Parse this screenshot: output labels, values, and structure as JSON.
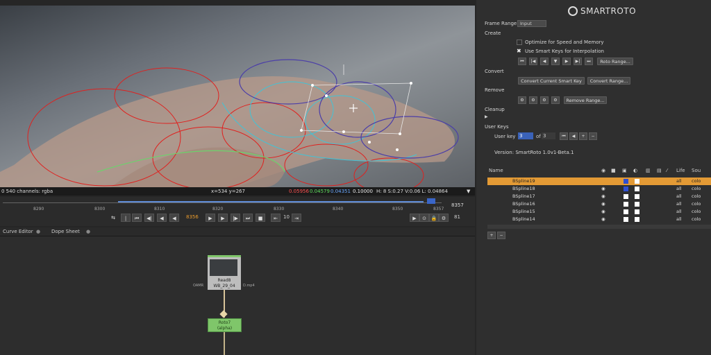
{
  "viewer": {
    "status_left": "0 540 channels: rgba",
    "coords": "x=534 y=267",
    "r": "0.05956",
    "g": "0.04579",
    "b": "0.04351",
    "a": "0.10000",
    "hsvl": "H: 8 S:0.27 V:0.06  L: 0.04864"
  },
  "timeline": {
    "ticks": [
      "8290",
      "8300",
      "8310",
      "8320",
      "8330",
      "8340",
      "8350",
      "8357"
    ],
    "end_frame": "8357",
    "current_frame": "8356",
    "step": "10",
    "fps": "81"
  },
  "tabs": [
    "Curve Editor",
    "Dope Sheet"
  ],
  "nodes": {
    "read": {
      "title": "Read8",
      "subtitle": "WB_29_04",
      "left_label": "OAMR",
      "right_label": "D.mp4"
    },
    "roto": {
      "title": "Roto7",
      "subtitle": "(alpha)"
    }
  },
  "panel": {
    "logo": "SMARTROTO",
    "frame_range_label": "Frame Range",
    "frame_range_value": "Input",
    "create_label": "Create",
    "optimize_label": "Optimize for Speed and Memory",
    "smart_keys_label": "Use Smart Keys for Interpolation",
    "roto_range_btn": "Roto Range...",
    "convert_label": "Convert",
    "convert_current_btn": "Convert Current Smart Key",
    "convert_range_btn": "Convert Range...",
    "remove_label": "Remove",
    "remove_range_btn": "Remove Range...",
    "cleanup_label": "Cleanup",
    "user_keys_label": "User Keys",
    "user_key_label": "User key",
    "user_key_value": "3",
    "of_label": "of",
    "of_value": "3",
    "version": "Version:  SmartRoto 1.0v1-Beta.1"
  },
  "table": {
    "headers": {
      "name": "Name",
      "life": "Life",
      "source": "Sou"
    },
    "rows": [
      {
        "name": "BSpline19",
        "life": "all",
        "src": "colo"
      },
      {
        "name": "BSpline18",
        "life": "all",
        "src": "colo"
      },
      {
        "name": "BSpline17",
        "life": "all",
        "src": "colo"
      },
      {
        "name": "BSpline16",
        "life": "all",
        "src": "colo"
      },
      {
        "name": "BSpline15",
        "life": "all",
        "src": "colo"
      },
      {
        "name": "BSpline14",
        "life": "all",
        "src": "colo"
      }
    ]
  },
  "colors": {
    "accent": "#e89a2c",
    "selected_row": "#e39a35",
    "node_green": "#7fc66a"
  }
}
